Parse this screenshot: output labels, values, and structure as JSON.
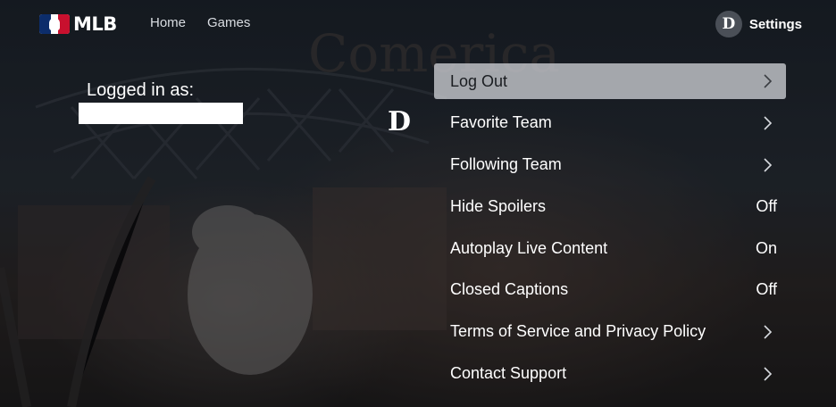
{
  "header": {
    "logo_text": "MLB",
    "nav": [
      "Home",
      "Games"
    ],
    "settings_label": "Settings",
    "team_badge_glyph": "D"
  },
  "account": {
    "logged_in_label": "Logged in as:",
    "username": ""
  },
  "team_logo_glyph": "D",
  "menu": [
    {
      "label": "Log Out",
      "value": null,
      "chevron": true,
      "selected": true
    },
    {
      "label": "Favorite Team",
      "value": null,
      "chevron": true,
      "selected": false
    },
    {
      "label": "Following Team",
      "value": null,
      "chevron": true,
      "selected": false
    },
    {
      "label": "Hide Spoilers",
      "value": "Off",
      "chevron": false,
      "selected": false
    },
    {
      "label": "Autoplay Live Content",
      "value": "On",
      "chevron": false,
      "selected": false
    },
    {
      "label": "Closed Captions",
      "value": "Off",
      "chevron": false,
      "selected": false
    },
    {
      "label": "Terms of Service and Privacy Policy",
      "value": null,
      "chevron": true,
      "selected": false
    },
    {
      "label": "Contact Support",
      "value": null,
      "chevron": true,
      "selected": false
    }
  ],
  "colors": {
    "mlb_blue": "#0c2d6b",
    "mlb_red": "#c8102e",
    "selected_row": "#c8cbd0"
  },
  "icons": {
    "chevron": "chevron-right-icon",
    "logo": "mlb-logo-icon",
    "team": "tigers-d-logo-icon"
  }
}
